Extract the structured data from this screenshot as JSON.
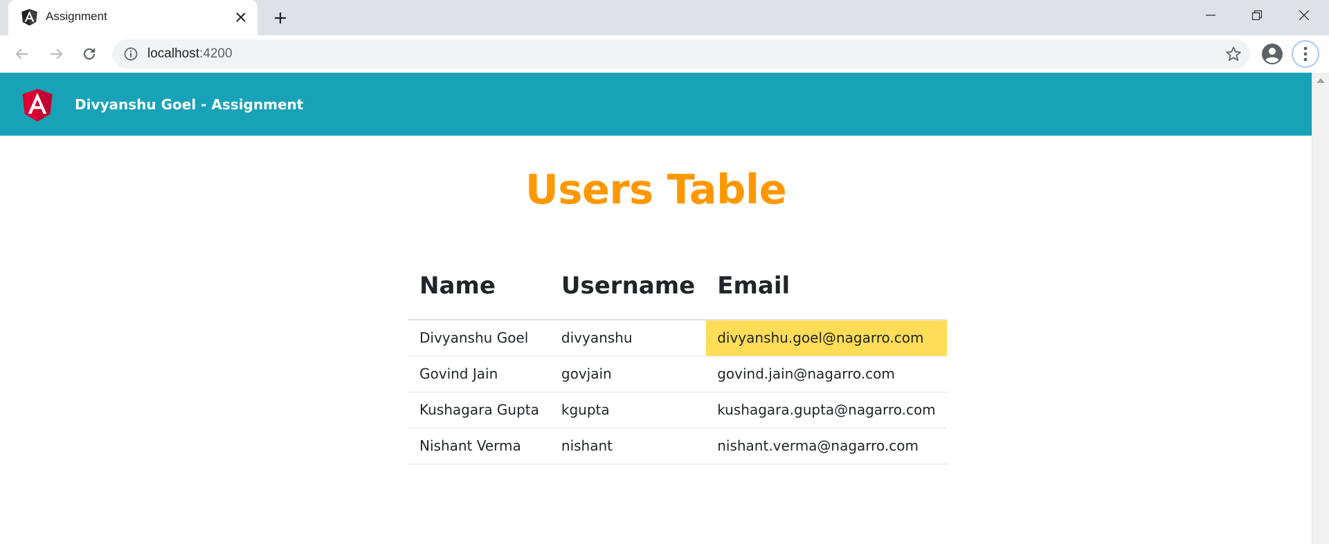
{
  "browser": {
    "tab_title": "Assignment",
    "url_host": "localhost",
    "url_port": ":4200"
  },
  "navbar": {
    "title": "Divyanshu Goel - Assignment"
  },
  "page": {
    "title": "Users Table"
  },
  "table": {
    "headers": [
      "Name",
      "Username",
      "Email"
    ],
    "rows": [
      {
        "name": "Divyanshu Goel",
        "username": "divyanshu",
        "email": "divyanshu.goel@nagarro.com",
        "email_highlighted": true
      },
      {
        "name": "Govind Jain",
        "username": "govjain",
        "email": "govind.jain@nagarro.com"
      },
      {
        "name": "Kushagara Gupta",
        "username": "kgupta",
        "email": "kushagara.gupta@nagarro.com"
      },
      {
        "name": "Nishant Verma",
        "username": "nishant",
        "email": "nishant.verma@nagarro.com"
      }
    ]
  },
  "colors": {
    "navbar": "#17a2b8",
    "title": "#ff9800",
    "highlight": "#ffdd57",
    "angular_red": "#dd0031"
  }
}
